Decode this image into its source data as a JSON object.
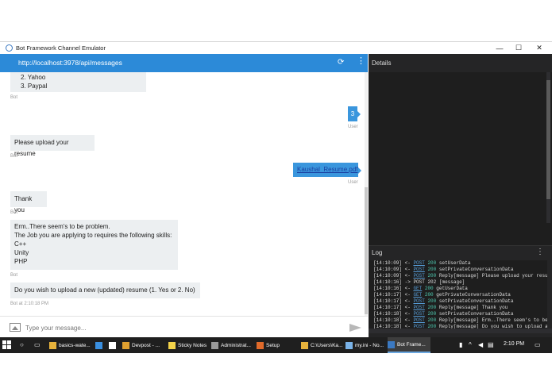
{
  "window": {
    "title": "Bot Framework Channel Emulator",
    "controls": [
      "—",
      "☐",
      "✕"
    ]
  },
  "address_bar": {
    "url": "http://localhost:3978/api/messages",
    "refresh_icon": "refresh-icon",
    "menu_icon": "kebab-menu-icon"
  },
  "messages": [
    {
      "from": "bot",
      "lines": [
        "2. Yahoo",
        "3. Paypal"
      ],
      "meta": "Bot"
    },
    {
      "from": "user",
      "text": "3",
      "meta": "User"
    },
    {
      "from": "bot",
      "lines": [
        "Please upload your resume"
      ],
      "meta": "Bot"
    },
    {
      "from": "user",
      "text": "Kaushal_Resume.pdf",
      "meta": "User",
      "is_link": true
    },
    {
      "from": "bot",
      "lines": [
        "Thank you"
      ],
      "meta": "Bot"
    },
    {
      "from": "bot",
      "lines": [
        "Erm..There seem's to be problem.",
        "The Job you are applying to requires the following skills:",
        "C++",
        "Unity",
        "PHP"
      ],
      "meta": "Bot"
    },
    {
      "from": "bot",
      "lines": [
        "Do you wish to upload a new (updated) resume (1. Yes or 2. No)"
      ],
      "meta": "Bot at 2:10:18 PM"
    }
  ],
  "input": {
    "placeholder": "Type your message..."
  },
  "details": {
    "title": "Details"
  },
  "log": {
    "title": "Log",
    "lines": [
      {
        "time": "[14:10:09]",
        "dir": "<-",
        "method": "POST",
        "status": "200",
        "text": "setUserData"
      },
      {
        "time": "[14:10:09]",
        "dir": "<-",
        "method": "POST",
        "status": "200",
        "text": "setPrivateConversationData"
      },
      {
        "time": "[14:10:09]",
        "dir": "<-",
        "method": "POST",
        "status": "200",
        "text": "Reply[message] Please upload your resu"
      },
      {
        "time": "[14:10:16]",
        "dir": "->",
        "method": "POST",
        "status": "202",
        "text": "[message]"
      },
      {
        "time": "[14:10:16]",
        "dir": "<-",
        "method": "GET",
        "status": "200",
        "text": "getUserData"
      },
      {
        "time": "[14:10:17]",
        "dir": "<-",
        "method": "GET",
        "status": "200",
        "text": "getPrivateConversationData"
      },
      {
        "time": "[14:10:17]",
        "dir": "<-",
        "method": "POST",
        "status": "200",
        "text": "setPrivateConversationData"
      },
      {
        "time": "[14:10:17]",
        "dir": "<-",
        "method": "POST",
        "status": "200",
        "text": "Reply[message] Thank you"
      },
      {
        "time": "[14:10:18]",
        "dir": "<-",
        "method": "POST",
        "status": "200",
        "text": "setPrivateConversationData"
      },
      {
        "time": "[14:10:18]",
        "dir": "<-",
        "method": "POST",
        "status": "200",
        "text": "Reply[message] Erm..There seem's to be"
      },
      {
        "time": "[14:10:18]",
        "dir": "<-",
        "method": "POST",
        "status": "200",
        "text": "Reply[message] Do you wish to upload a"
      }
    ]
  },
  "taskbar": {
    "items": [
      {
        "label": "basics-wate...",
        "icon": "folder-icon",
        "color": "#e8b33c"
      },
      {
        "label": "",
        "icon": "edge-icon",
        "color": "#3a8fe0"
      },
      {
        "label": "",
        "icon": "store-icon",
        "color": "#ffffff"
      },
      {
        "label": "Devpost - ...",
        "icon": "chrome-icon",
        "color": "#e0a030"
      },
      {
        "label": "Sticky Notes",
        "icon": "sticky-notes-icon",
        "color": "#f3d34a"
      },
      {
        "label": "Administrat...",
        "icon": "cmd-icon",
        "color": "#999999"
      },
      {
        "label": "Setup",
        "icon": "setup-icon",
        "color": "#e06a2a"
      },
      {
        "label": "C:\\Users\\Ka...",
        "icon": "folder-icon",
        "color": "#e8b33c"
      },
      {
        "label": "my.ini - No...",
        "icon": "notepad-icon",
        "color": "#7ab3e8"
      },
      {
        "label": "Bot Frame...",
        "icon": "bot-emulator-icon",
        "color": "#3b79c2"
      }
    ],
    "clock": "2:10 PM"
  }
}
